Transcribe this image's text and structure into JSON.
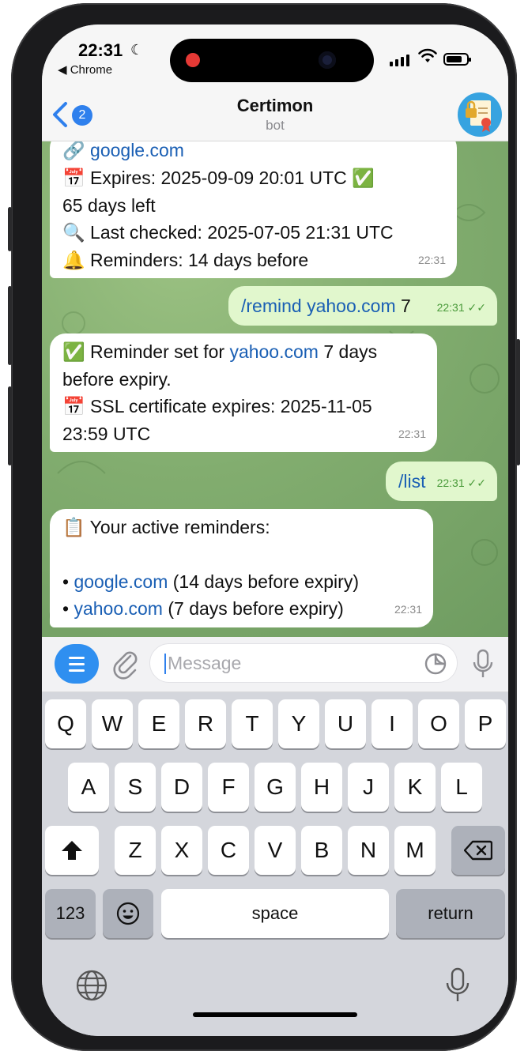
{
  "status_bar": {
    "time": "22:31",
    "back_app": "◀ Chrome"
  },
  "header": {
    "back_badge": "2",
    "title": "Certimon",
    "subtitle": "bot"
  },
  "messages": {
    "m1": {
      "line1_link": "google.com",
      "line2": "Expires: 2025-09-09 20:01 UTC",
      "line3": "65 days left",
      "line4": "Last checked: 2025-07-05 21:31 UTC",
      "line5": "Reminders: 14 days before",
      "time": "22:31"
    },
    "m2": {
      "command": "/remind",
      "link": "yahoo.com",
      "arg": "7",
      "time": "22:31"
    },
    "m3": {
      "prefix": "Reminder set for",
      "link": "yahoo.com",
      "suffix": "7 days",
      "line2": "before expiry.",
      "line3": "SSL certificate expires: 2025-11-05",
      "line4": "23:59 UTC",
      "time": "22:31"
    },
    "m4": {
      "command": "/list",
      "time": "22:31"
    },
    "m5": {
      "heading": "Your active reminders:",
      "item1_link": "google.com",
      "item1_text": "(14 days before expiry)",
      "item2_link": "yahoo.com",
      "item2_text": "(7 days before expiry)",
      "time": "22:31"
    }
  },
  "input": {
    "placeholder": "Message"
  },
  "keyboard": {
    "row1": [
      "Q",
      "W",
      "E",
      "R",
      "T",
      "Y",
      "U",
      "I",
      "O",
      "P"
    ],
    "row2": [
      "A",
      "S",
      "D",
      "F",
      "G",
      "H",
      "J",
      "K",
      "L"
    ],
    "row3": [
      "Z",
      "X",
      "C",
      "V",
      "B",
      "N",
      "M"
    ],
    "numbers_label": "123",
    "space_label": "space",
    "return_label": "return"
  },
  "colors": {
    "accent": "#2f80ed",
    "outgoing_bubble": "#e1f7cd",
    "chat_background": "#82ad6f"
  }
}
